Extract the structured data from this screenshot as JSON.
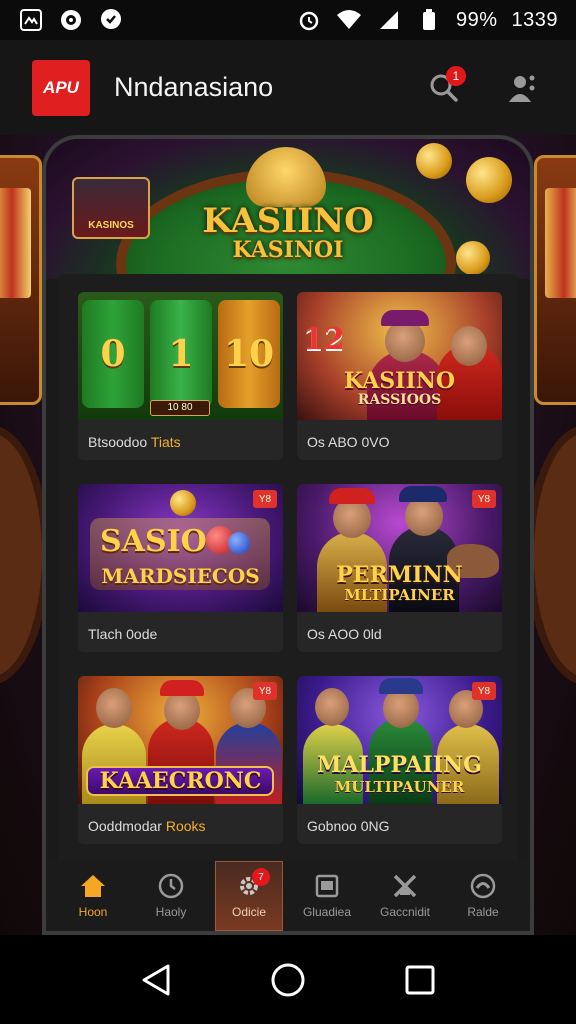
{
  "status_bar": {
    "left_icons": [
      "screenshot-icon",
      "gamepad-icon",
      "chat-bubble-icon"
    ],
    "right_icons": [
      "alarm-icon",
      "wifi-icon",
      "signal-icon",
      "battery-saver-icon"
    ],
    "battery": "99%",
    "time": "1339"
  },
  "app_bar": {
    "logo_text": "APU",
    "title": "Nndanasiano",
    "search_icon": "search-icon",
    "notification_count": "1",
    "profile_icon": "profile-icon"
  },
  "hero": {
    "title_line1": "KASIINO",
    "title_line2": "KASINOI",
    "badge_text": "KASINOS"
  },
  "games": [
    {
      "art_reels": [
        "0",
        "1",
        "10"
      ],
      "art_tag": "10 80",
      "caption": "Btsoodoo",
      "caption_accent": "Tiats"
    },
    {
      "art_line1": "KASIINO",
      "art_line2": "RASSIOOS",
      "art_number": "12",
      "caption": "Os ABO 0VO",
      "caption_accent": ""
    },
    {
      "art_line1": "SASIO",
      "art_line2": "MARDSIECOS",
      "chip": "Y8",
      "caption": "Tlach 0ode",
      "caption_accent": ""
    },
    {
      "art_line1": "PERMINN",
      "art_line2": "MLTIPAINER",
      "chip": "Y8",
      "caption": "Os AOO 0ld",
      "caption_accent": ""
    },
    {
      "art_line1": "KAAECRONC",
      "chip": "Y8",
      "caption": "Ooddmodar",
      "caption_accent": "Rooks"
    },
    {
      "art_line1": "MALPPAIING",
      "art_line2": "MULTIPAUNER",
      "chip": "Y8",
      "caption": "Gobnoo 0NG",
      "caption_accent": ""
    }
  ],
  "bottom_nav": {
    "items": [
      {
        "label": "Hoon",
        "icon": "home-icon",
        "active": true
      },
      {
        "label": "Haoly",
        "icon": "clock-icon",
        "active": false
      },
      {
        "label": "Odicie",
        "icon": "gear-icon",
        "active": false,
        "badge": "7"
      },
      {
        "label": "Gluadiea",
        "icon": "slot-machine-icon",
        "active": false
      },
      {
        "label": "Gaccnidit",
        "icon": "crossed-swords-icon",
        "active": false
      },
      {
        "label": "Ralde",
        "icon": "profile-circle-icon",
        "active": false
      }
    ]
  },
  "system_nav": {
    "back": "back-triangle-icon",
    "home": "home-circle-icon",
    "recents": "recents-square-icon"
  },
  "colors": {
    "accent": "#f5a623",
    "badge": "#e3181b",
    "brand": "#e02020"
  }
}
